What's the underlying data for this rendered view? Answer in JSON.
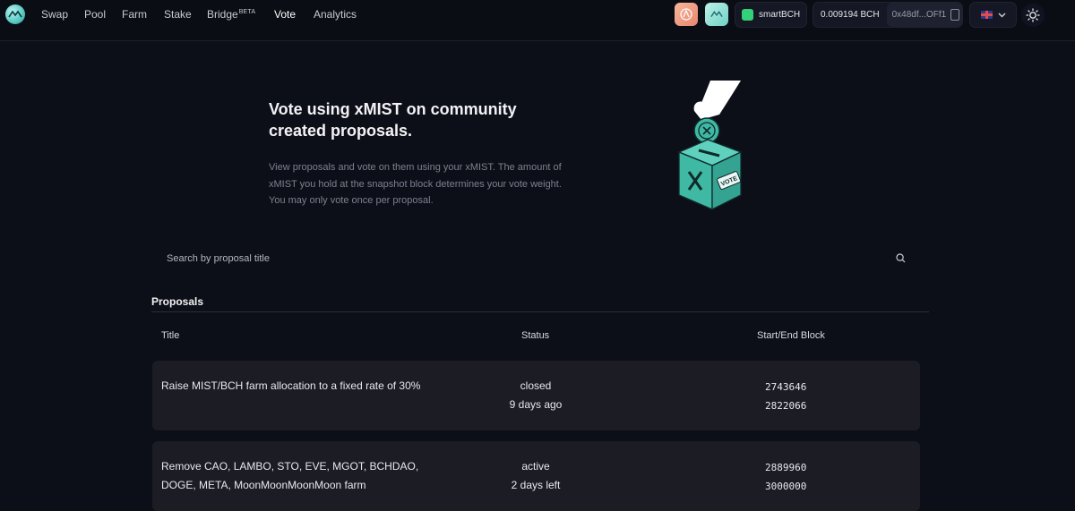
{
  "nav": {
    "items": [
      {
        "label": "Swap"
      },
      {
        "label": "Pool"
      },
      {
        "label": "Farm"
      },
      {
        "label": "Stake"
      },
      {
        "label": "Bridge",
        "badge": "BETA"
      },
      {
        "label": "Vote",
        "active": true
      },
      {
        "label": "Analytics"
      }
    ]
  },
  "account": {
    "network": "smartBCH",
    "balance": "0.009194 BCH",
    "address": "0x48df...OFf1"
  },
  "hero": {
    "title": "Vote using xMIST on community created proposals.",
    "description": "View proposals and vote on them using your xMIST. The amount of xMIST you hold at the snapshot block determines your vote weight. You may only vote once per proposal.",
    "illustration_text": "VOTE"
  },
  "search": {
    "placeholder": "Search by proposal title"
  },
  "proposals": {
    "heading": "Proposals",
    "columns": {
      "title": "Title",
      "status": "Status",
      "blocks": "Start/End Block"
    },
    "rows": [
      {
        "title": "Raise MIST/BCH farm allocation to a fixed rate of 30%",
        "status": "closed",
        "time": "9 days ago",
        "start_block": "2743646",
        "end_block": "2822066"
      },
      {
        "title": "Remove CAO, LAMBO, STO, EVE, MGOT, BCHDAO, DOGE, META, MoonMoonMoonMoon farm",
        "status": "active",
        "time": "2 days left",
        "start_block": "2889960",
        "end_block": "3000000"
      }
    ]
  },
  "colors": {
    "background": "#0d0f18",
    "row_background": "#1b1c24",
    "accent_teal": "#3fb8a4",
    "network_green": "#33d17a"
  }
}
